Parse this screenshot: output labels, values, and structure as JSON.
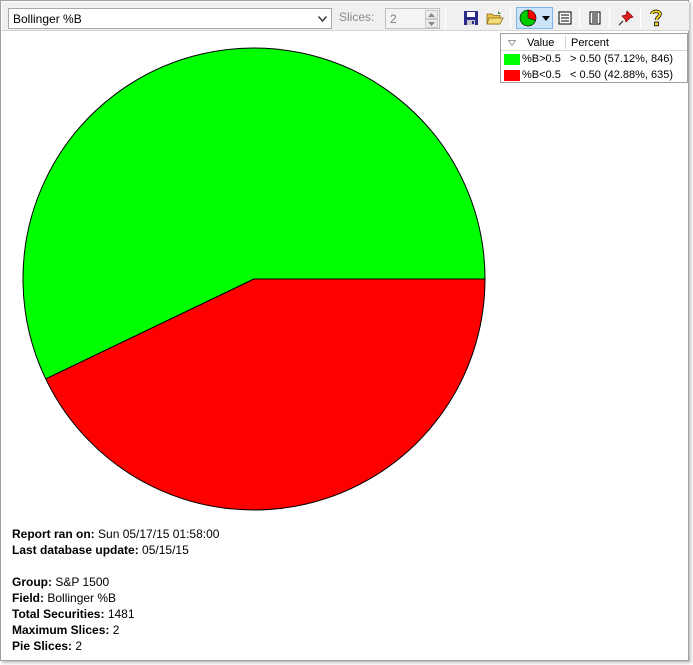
{
  "toolbar": {
    "field_select": {
      "value": "Bollinger %B"
    },
    "slices": {
      "label": "Slices:",
      "value": "2"
    },
    "icons": [
      "save-icon",
      "open-folder-icon",
      "pie-chart-icon",
      "dropdown-arrow-icon",
      "list-view-icon",
      "report-view-icon",
      "pin-icon",
      "help-icon"
    ]
  },
  "legend": {
    "headers": {
      "value": "Value",
      "percent": "Percent"
    },
    "rows": [
      {
        "label": "%B>0.5",
        "percent": "> 0.50 (57.12%, 846)",
        "color": "#00ff00"
      },
      {
        "label": "%B<0.5",
        "percent": "< 0.50 (42.88%, 635)",
        "color": "#ff0000"
      }
    ]
  },
  "chart_data": {
    "type": "pie",
    "categories": [
      "%B>0.5",
      "%B<0.5"
    ],
    "values": [
      846,
      635
    ],
    "percentages": [
      57.12,
      42.88
    ],
    "colors": [
      "#00ff00",
      "#ff0000"
    ]
  },
  "report": {
    "ran_on": {
      "label": "Report ran on:",
      "value": "Sun 05/17/15 01:58:00"
    },
    "db_update": {
      "label": "Last database update:",
      "value": "05/15/15"
    },
    "group": {
      "label": "Group:",
      "value": "S&P 1500"
    },
    "field": {
      "label": "Field:",
      "value": "Bollinger %B"
    },
    "total": {
      "label": "Total Securities:",
      "value": "1481"
    },
    "max_slices": {
      "label": "Maximum Slices:",
      "value": "2"
    },
    "pie_slices": {
      "label": "Pie Slices:",
      "value": "2"
    }
  }
}
